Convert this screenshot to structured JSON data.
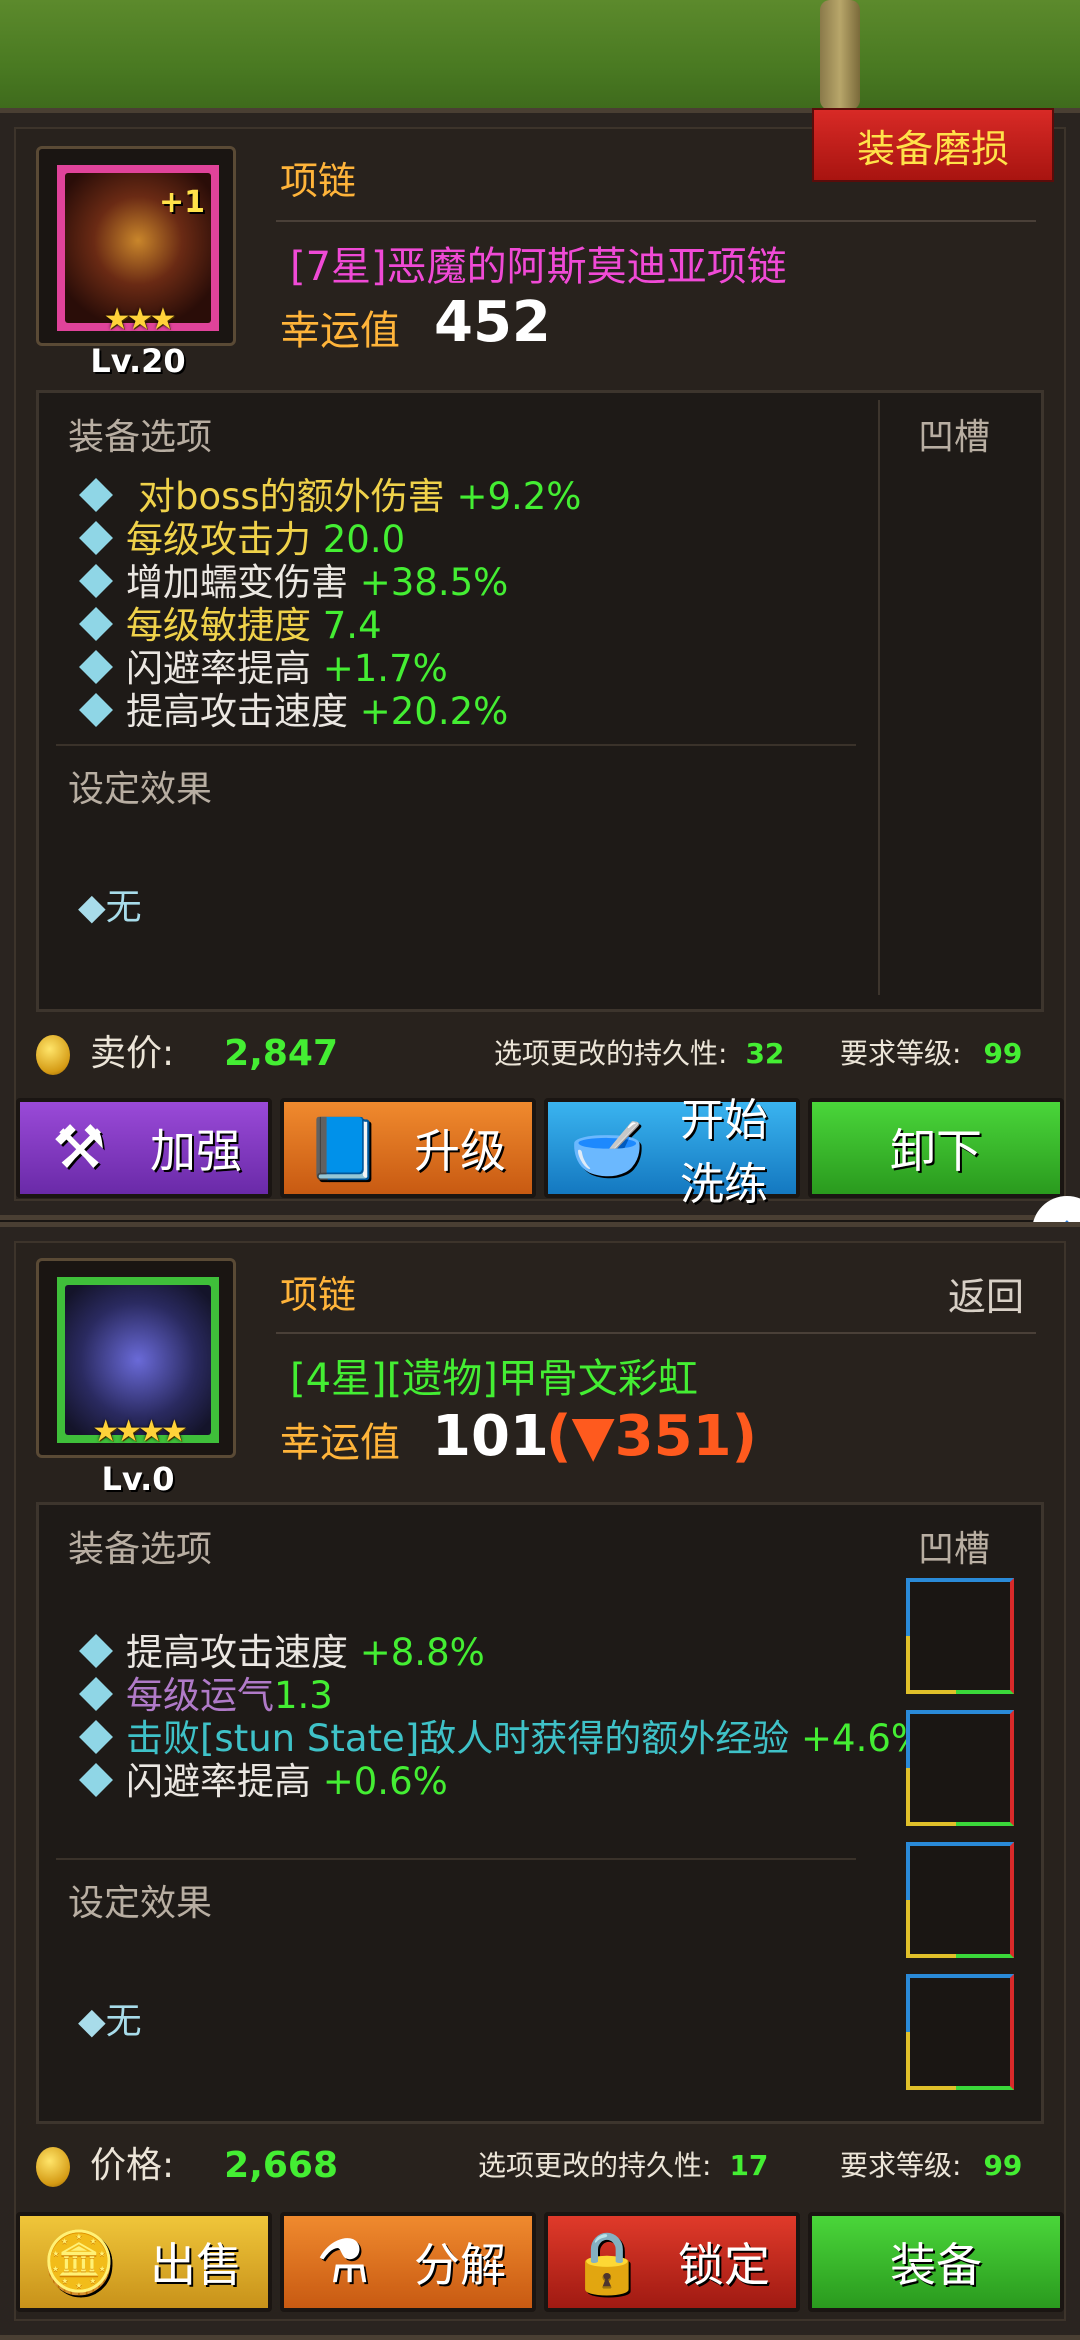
{
  "item1": {
    "category": "项链",
    "wear_badge": "装备磨损",
    "name": "[7星]恶魔的阿斯莫迪亚项链",
    "enhance": "+1",
    "stars": "★★★",
    "level": "Lv.20",
    "luck_label": "幸运值",
    "luck_value": "452",
    "options_label": "装备选项",
    "socket_label": "凹槽",
    "options": [
      {
        "name": "对boss的额外伤害",
        "value": "+9.2%"
      },
      {
        "name": "每级攻击力",
        "value": "20.0"
      },
      {
        "name": "增加蠕变伤害",
        "value": "+38.5%"
      },
      {
        "name": "每级敏捷度",
        "value": "7.4"
      },
      {
        "name": "闪避率提高",
        "value": "+1.7%"
      },
      {
        "name": "提高攻击速度",
        "value": "+20.2%"
      }
    ],
    "set_label": "设定效果",
    "set_value": "◆无",
    "price_label": "卖价:",
    "price_value": "2,847",
    "durability_label": "选项更改的持久性:",
    "durability_value": "32",
    "req_label": "要求等级:",
    "req_value": "99",
    "buttons": [
      "加强",
      "升级",
      "开始洗练",
      "卸下"
    ]
  },
  "item2": {
    "category": "项链",
    "back_label": "返回",
    "name": "[4星][遗物]甲骨文彩虹",
    "stars": "★★★★",
    "level": "Lv.0",
    "luck_label": "幸运值",
    "luck_value": "101",
    "luck_diff": "(▼351)",
    "options_label": "装备选项",
    "socket_label": "凹槽",
    "options": [
      {
        "name": "提高攻击速度",
        "value": "+8.8%"
      },
      {
        "name": "每级运气",
        "value": "1.3"
      },
      {
        "name": "击败[stun State]敌人时获得的额外经验",
        "value": "+4.6%"
      },
      {
        "name": "闪避率提高",
        "value": "+0.6%"
      }
    ],
    "set_label": "设定效果",
    "set_value": "◆无",
    "price_label": "价格:",
    "price_value": "2,668",
    "durability_label": "选项更改的持久性:",
    "durability_value": "17",
    "req_label": "要求等级:",
    "req_value": "99",
    "buttons": [
      "出售",
      "分解",
      "锁定",
      "装备"
    ]
  }
}
